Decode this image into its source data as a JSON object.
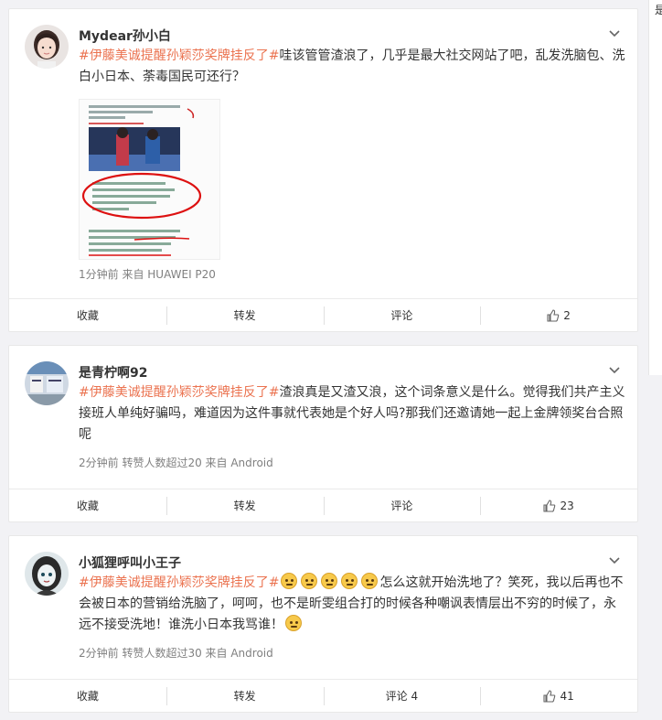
{
  "right_panel": {
    "glyph": "是"
  },
  "posts": [
    {
      "username": "Mydear孙小白",
      "hashtag_part1": "#伊藤美诚",
      "hashtag_part2": "提醒孙颖莎奖牌挂反了#",
      "text": "哇该管管渣浪了，几乎是最大社交网站了吧，乱发洗脑包、洗白小日本、荼毒国民可还行？",
      "meta": "1分钟前  来自 HUAWEI P20",
      "actions": {
        "collect": "收藏",
        "repost": "转发",
        "comment": "评论",
        "like_count": "2"
      }
    },
    {
      "username": "是青柠啊92",
      "hashtag_part1": "#伊藤美诚",
      "hashtag_part2": "提醒孙颖莎奖牌挂反了#",
      "text": "渣浪真是又渣又浪，这个词条意义是什么。觉得我们共产主义接班人单纯好骗吗，难道因为这件事就代表她是个好人吗?那我们还邀请她一起上金牌领奖台合照呢",
      "meta": "2分钟前  转赞人数超过20  来自 Android",
      "actions": {
        "collect": "收藏",
        "repost": "转发",
        "comment": "评论",
        "like_count": "23"
      }
    },
    {
      "username": "小狐狸呼叫小王子",
      "hashtag_part1": "#伊藤美诚",
      "hashtag_part2": "提醒孙颖莎奖牌挂反了#",
      "text_a": "怎么这就开始洗地了？笑死，我以后再也不会被日本的营销给洗脑了，呵呵，也不是昕雯组合打的时候各种嘲讽表情层出不穷的时候了，永远不接受洗地！谁洗小日本我骂谁！",
      "meta": "2分钟前  转赞人数超过30  来自 Android",
      "actions": {
        "collect": "收藏",
        "repost": "转发",
        "comment": "评论 4",
        "like_count": "41"
      }
    }
  ],
  "icons": {
    "chevron": "chevron-down-icon",
    "like": "thumbs-up-icon",
    "emoji": "sweat-smile-emoji"
  },
  "colors": {
    "tag": "#eb7350",
    "meta": "#808080",
    "bg": "#f2f2f5"
  }
}
